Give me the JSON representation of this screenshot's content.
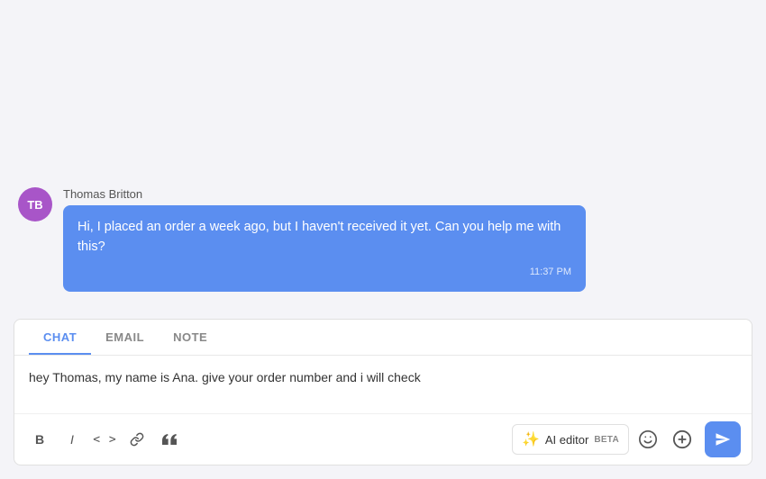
{
  "chat": {
    "background_color": "#f4f4f8"
  },
  "message": {
    "sender_name": "Thomas Britton",
    "avatar_initials": "TB",
    "avatar_color": "#a855c8",
    "text": "Hi, I placed an order a week ago, but I haven't received it yet. Can you help me with this?",
    "timestamp": "11:37 PM"
  },
  "composer": {
    "tabs": [
      {
        "label": "CHAT",
        "active": true
      },
      {
        "label": "EMAIL",
        "active": false
      },
      {
        "label": "NOTE",
        "active": false
      }
    ],
    "draft_text": "hey Thomas, my name is Ana. give your order number and i will check",
    "ai_editor_label": "AI editor",
    "beta_label": "BETA",
    "toolbar": {
      "bold_label": "B",
      "italic_label": "I",
      "code_left": "<",
      "code_right": ">",
      "link_label": "🔗",
      "quote_label": "❝"
    }
  }
}
